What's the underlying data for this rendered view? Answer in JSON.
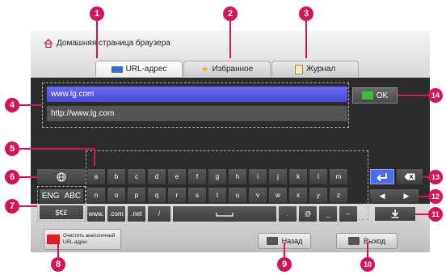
{
  "browser": {
    "home_label": "Домашняя страница браузера"
  },
  "tabs": [
    {
      "label": "URL-адрес",
      "icon": "url-icon"
    },
    {
      "label": "Избранное",
      "icon": "star-icon"
    },
    {
      "label": "Журнал",
      "icon": "journal-icon"
    }
  ],
  "url": {
    "input_value": "www.lg.com",
    "suggestion": "http://www.lg.com",
    "ok_label": "OK"
  },
  "keyboard": {
    "row1": [
      "a",
      "b",
      "c",
      "d",
      "e",
      "f",
      "g",
      "h",
      "i",
      "j",
      "k",
      "l",
      "m"
    ],
    "row2": [
      "n",
      "o",
      "p",
      "q",
      "r",
      "s",
      "t",
      "u",
      "v",
      "w",
      "x",
      "y",
      "z"
    ],
    "row3_left": [
      "www.",
      ".com",
      ".net",
      "/"
    ],
    "row3_right": [
      ".",
      "@",
      "_",
      "–"
    ],
    "lang_eng": "ENG",
    "lang_abc": "ABC",
    "currency": "$€£"
  },
  "bottom": {
    "clear_label_1": "Очистить аналогичный",
    "clear_label_2": "URL-адрес",
    "back_label": "Назад",
    "exit_label": "Выход"
  },
  "callouts": [
    "1",
    "2",
    "3",
    "4",
    "5",
    "6",
    "7",
    "8",
    "9",
    "10",
    "11",
    "12",
    "13",
    "14"
  ],
  "colors": {
    "callout": "#d4145a",
    "url_input": "#5a5ae8",
    "enter_key": "#4a6cf0",
    "clear_red": "#e02020",
    "ok_green": "#3bbd3b"
  }
}
